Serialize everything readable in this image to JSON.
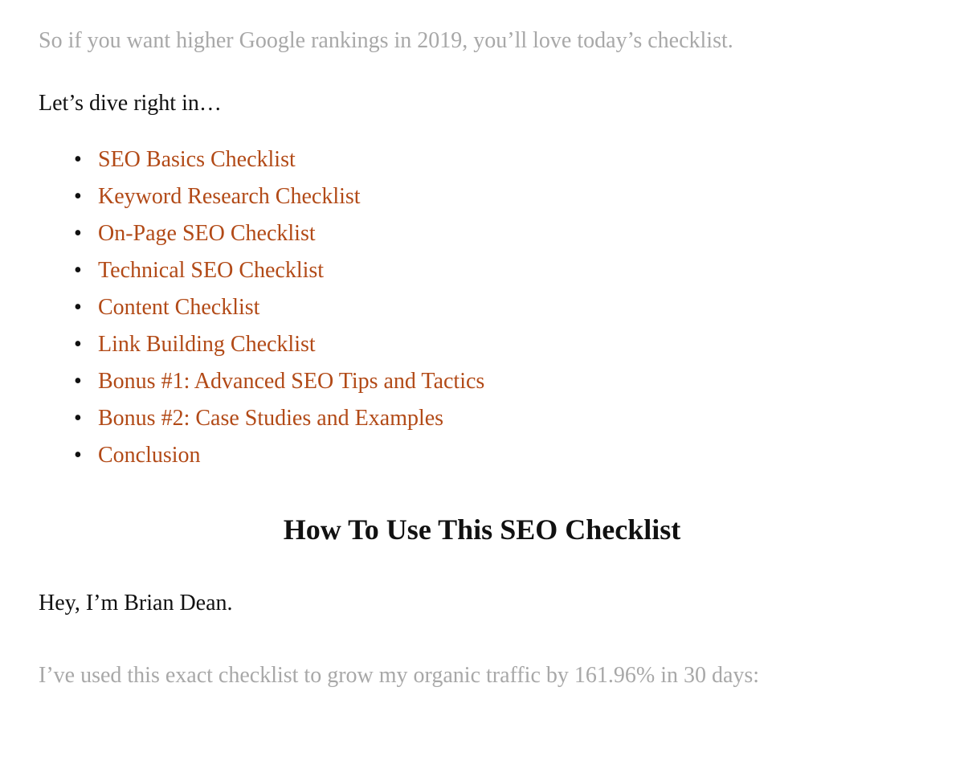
{
  "intro": "So if you want higher Google rankings in 2019, you’ll love today’s checklist.",
  "lead_in": "Let’s dive right in…",
  "toc": {
    "items": [
      "SEO Basics Checklist",
      "Keyword Research Checklist",
      "On-Page SEO Checklist",
      "Technical SEO Checklist",
      "Content Checklist",
      "Link Building Checklist",
      "Bonus #1: Advanced SEO Tips and Tactics",
      "Bonus #2: Case Studies and Examples",
      "Conclusion"
    ]
  },
  "heading": "How To Use This SEO Checklist",
  "body_line": "Hey, I’m Brian Dean.",
  "body_faded": "I’ve used this exact checklist to grow my organic traffic by 161.96% in 30 days:",
  "colors": {
    "link": "#b24a17",
    "faded": "#a8a8a8",
    "text": "#111111"
  }
}
